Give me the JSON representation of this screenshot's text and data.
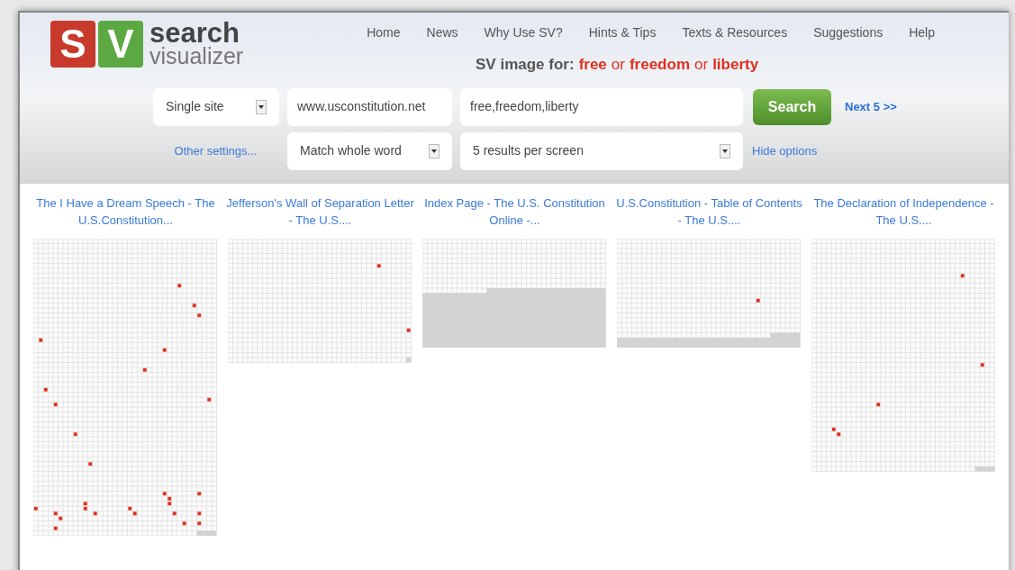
{
  "logo": {
    "letters": [
      "S",
      "V"
    ],
    "word_top": "search",
    "word_bottom": "visualizer"
  },
  "nav": [
    "Home",
    "News",
    "Why Use SV?",
    "Hints & Tips",
    "Texts & Resources",
    "Suggestions",
    "Help"
  ],
  "query_heading": {
    "label": "SV image for:",
    "parts": [
      {
        "kind": "term",
        "text": "free"
      },
      {
        "kind": "joiner",
        "text": "or"
      },
      {
        "kind": "term",
        "text": "freedom"
      },
      {
        "kind": "joiner",
        "text": "or"
      },
      {
        "kind": "term",
        "text": "liberty"
      }
    ]
  },
  "form": {
    "scope_select": "Single site",
    "site_field": "www.usconstitution.net",
    "terms_field": "free,freedom,liberty",
    "search_button": "Search",
    "next_link": "Next 5 >>",
    "other_settings_link": "Other settings...",
    "match_select": "Match whole word",
    "results_select": "5 results per screen",
    "hide_options_link": "Hide options"
  },
  "results": [
    {
      "title": "The I Have a Dream Speech - The U.S.Constitution..."
    },
    {
      "title": "Jefferson's Wall of Separation Letter - The U.S...."
    },
    {
      "title": "Index Page - The U.S. Constitution Online -..."
    },
    {
      "title": "U.S.Constitution - Table of Contents - The U.S...."
    },
    {
      "title": "The Declaration of Independence - The U.S...."
    }
  ]
}
